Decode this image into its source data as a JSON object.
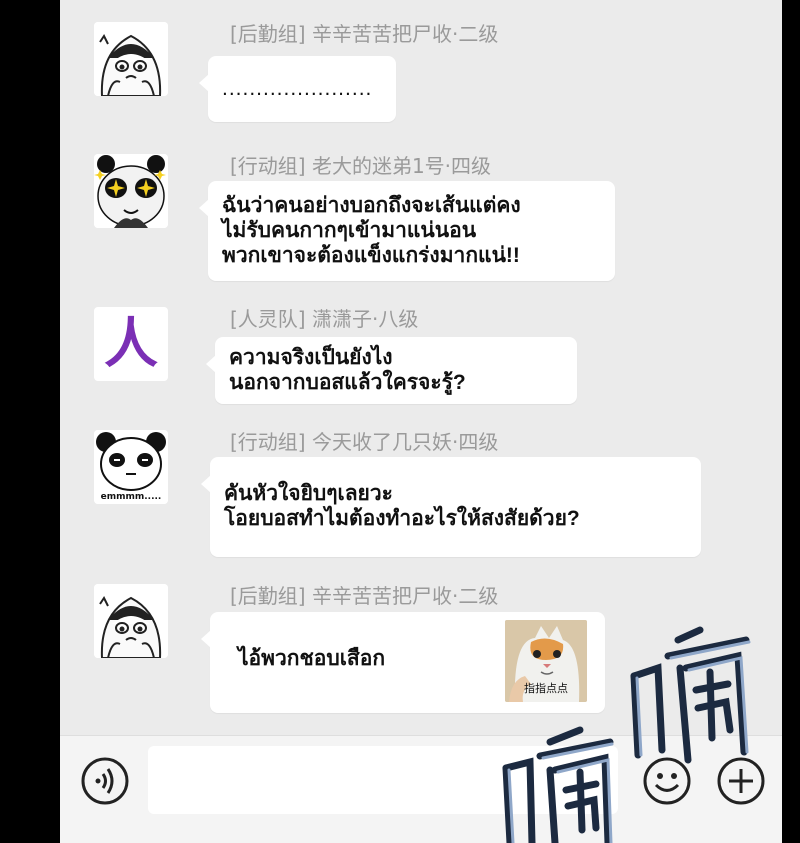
{
  "messages": [
    {
      "sender": "[后勤组]  辛辛苦苦把尸收·二级",
      "text": "......................",
      "avatar": "crying-girl-icon"
    },
    {
      "sender": "[行动组]  老大的迷弟1号·四级",
      "text": "ฉันว่าคนอย่างบอกถึงจะเส้นแต่คง\nไม่รับคนกากๆเข้ามาแน่นอน\nพวกเขาจะต้องแข็งแกร่งมากแน่!!",
      "avatar": "starry-eyed-panda-icon"
    },
    {
      "sender": "[人灵队]  潇潇子·八级",
      "text": "ความจริงเป็นยังไง\nนอกจากบอสแล้วใครจะรู้?",
      "avatar": "ren-character-icon",
      "avatar_text": "人"
    },
    {
      "sender": "[行动组]  今天收了几只妖·四级",
      "text": "คันหัวใจยิบๆเลยวะ\nโอยบอสทำไมต้องทำอะไรให้สงสัยด้วย?",
      "avatar": "emmm-panda-icon",
      "avatar_caption": "emmmm....."
    },
    {
      "sender": "[后勤组]  辛辛苦苦把尸收·二级",
      "text": "ไอ้พวกชอบเสือก",
      "avatar": "crying-girl-icon",
      "sticker": {
        "icon": "pointing-cat-sticker",
        "caption": "指指点点"
      }
    }
  ],
  "input_bar": {
    "voice_icon": "voice-icon",
    "emoji_icon": "smiley-icon",
    "add_icon": "plus-icon"
  },
  "colors": {
    "background": "#ebebeb",
    "bubble": "#ffffff",
    "sender_text": "#9a9a9a",
    "sfx": "#8fa7c9"
  }
}
